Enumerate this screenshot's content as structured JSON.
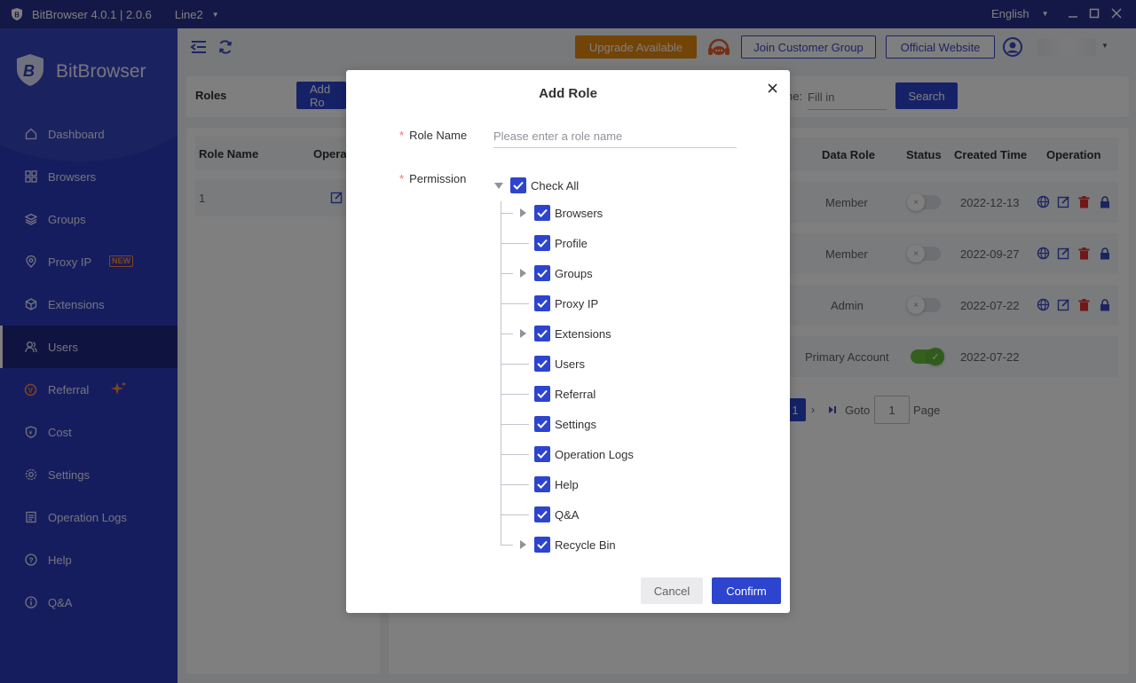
{
  "titlebar": {
    "title": "BitBrowser 4.0.1 | 2.0.6",
    "line": "Line2",
    "language": "English"
  },
  "sidebar": {
    "brand": "BitBrowser",
    "new_badge": "NEW",
    "items": [
      {
        "label": "Dashboard",
        "icon": "home-icon"
      },
      {
        "label": "Browsers",
        "icon": "grid-icon"
      },
      {
        "label": "Groups",
        "icon": "layers-icon"
      },
      {
        "label": "Proxy IP",
        "icon": "location-icon"
      },
      {
        "label": "Extensions",
        "icon": "cube-icon"
      },
      {
        "label": "Users",
        "icon": "users-icon"
      },
      {
        "label": "Referral",
        "icon": "referral-icon"
      },
      {
        "label": "Cost",
        "icon": "shield-icon"
      },
      {
        "label": "Settings",
        "icon": "gear-icon"
      },
      {
        "label": "Operation Logs",
        "icon": "log-icon"
      },
      {
        "label": "Help",
        "icon": "help-icon"
      },
      {
        "label": "Q&A",
        "icon": "info-icon"
      }
    ]
  },
  "topbar": {
    "upgrade": "Upgrade Available",
    "join_group": "Join Customer Group",
    "official_site": "Official Website"
  },
  "roles_panel": {
    "title": "Roles",
    "add_button": "Add Ro",
    "col_role_name": "Role Name",
    "col_operation": "Opera",
    "rows": [
      {
        "name": "1"
      }
    ]
  },
  "users_panel": {
    "search_label": "ne:",
    "search_placeholder": "Fill in",
    "search_button": "Search",
    "headers": {
      "data_role": "Data Role",
      "status": "Status",
      "created": "Created Time",
      "operation": "Operation"
    },
    "rows": [
      {
        "data_role": "Member",
        "status": "off",
        "created": "2022-12-13"
      },
      {
        "data_role": "Member",
        "status": "off",
        "created": "2022-09-27"
      },
      {
        "data_role": "Admin",
        "status": "off",
        "created": "2022-07-22"
      },
      {
        "data_role": "Primary Account",
        "status": "on",
        "created": "2022-07-22"
      }
    ],
    "pagination": {
      "current": "1",
      "goto": "Goto",
      "goto_value": "1",
      "page": "Page"
    }
  },
  "dialog": {
    "title": "Add Role",
    "role_name_label": "Role Name",
    "role_name_placeholder": "Please enter a role name",
    "permission_label": "Permission",
    "check_all": "Check All",
    "permissions": [
      {
        "label": "Browsers",
        "expandable": true,
        "checked": true
      },
      {
        "label": "Profile",
        "expandable": false,
        "checked": true
      },
      {
        "label": "Groups",
        "expandable": true,
        "checked": true
      },
      {
        "label": "Proxy IP",
        "expandable": false,
        "checked": true
      },
      {
        "label": "Extensions",
        "expandable": true,
        "checked": true
      },
      {
        "label": "Users",
        "expandable": false,
        "checked": true
      },
      {
        "label": "Referral",
        "expandable": false,
        "checked": true
      },
      {
        "label": "Settings",
        "expandable": false,
        "checked": true
      },
      {
        "label": "Operation Logs",
        "expandable": false,
        "checked": true
      },
      {
        "label": "Help",
        "expandable": false,
        "checked": true
      },
      {
        "label": "Q&A",
        "expandable": false,
        "checked": true
      },
      {
        "label": "Recycle Bin",
        "expandable": true,
        "checked": true
      }
    ],
    "cancel": "Cancel",
    "confirm": "Confirm"
  },
  "colors": {
    "titlebar": "#26318f",
    "sidebar": "#2c3bbd",
    "primary": "#2d44cf",
    "upgrade": "#e6890f",
    "required": "#f56c6c"
  }
}
